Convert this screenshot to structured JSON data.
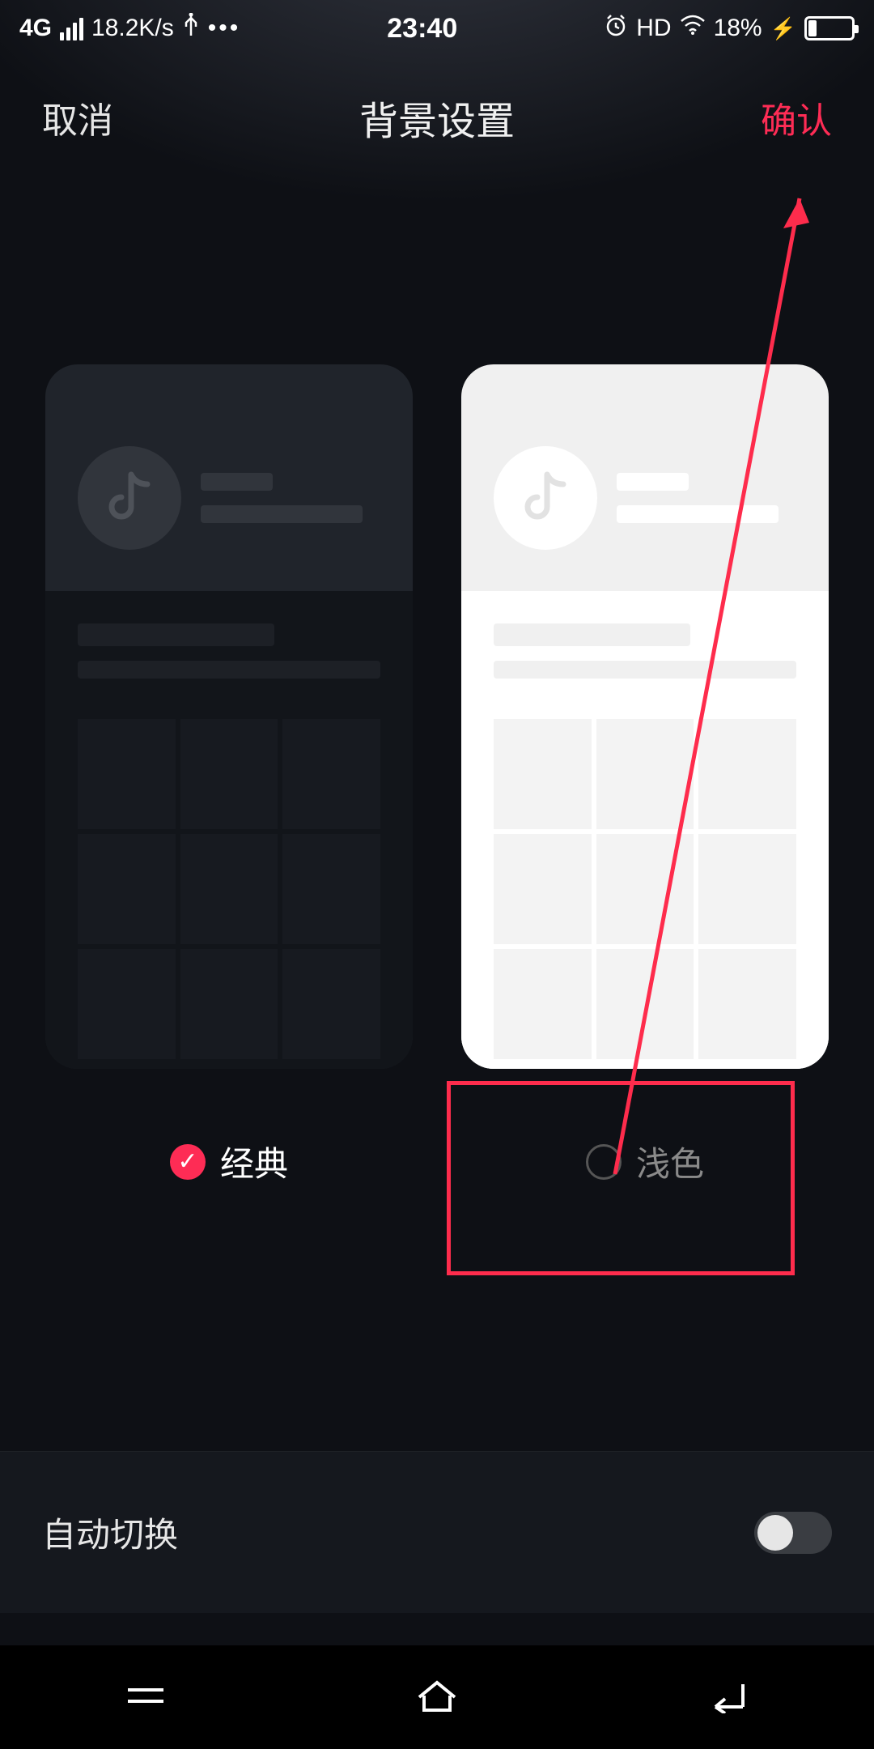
{
  "statusbar": {
    "network": "4G",
    "speed": "18.2K/s",
    "time": "23:40",
    "hd": "HD",
    "battery_percent": "18%"
  },
  "navbar": {
    "cancel": "取消",
    "title": "背景设置",
    "confirm": "确认"
  },
  "themes": {
    "classic": {
      "label": "经典",
      "selected": true
    },
    "light": {
      "label": "浅色",
      "selected": false
    }
  },
  "auto_switch": {
    "label": "自动切换",
    "value": false
  },
  "accent_color": "#fe2c55"
}
